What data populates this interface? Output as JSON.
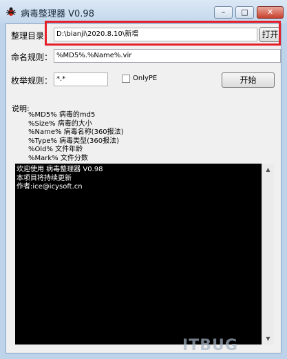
{
  "window": {
    "title": "病毒整理器 V0.98",
    "controls": {
      "minimize": "–",
      "maximize": "□",
      "close": "✕"
    }
  },
  "form": {
    "dir_label": "整理目录：",
    "dir_value": "D:\\bianji\\2020.8.10\\新增",
    "open_button": "打开",
    "naming_label": "命名规则：",
    "naming_value": "%MD5%.%Name%.vir",
    "enum_label": "枚举规则：",
    "enum_value": "*.*",
    "onlype_label": "OnlyPE",
    "onlype_checked": false,
    "start_button": "开始"
  },
  "description": {
    "title": "说明:",
    "lines": [
      "%MD5%  病毒的md5",
      "%Size%  病毒的大小",
      "%Name%  病毒名称(360报法)",
      "%Type%  病毒类型(360报法)",
      "%Old%   文件年龄",
      "%Mark%  文件分数"
    ]
  },
  "console": {
    "lines": [
      "欢迎使用 病毒整理器 V0.98",
      "本项目将持续更新",
      "作者:ice@icysoft.cn"
    ]
  },
  "watermark": "ITBUG"
}
